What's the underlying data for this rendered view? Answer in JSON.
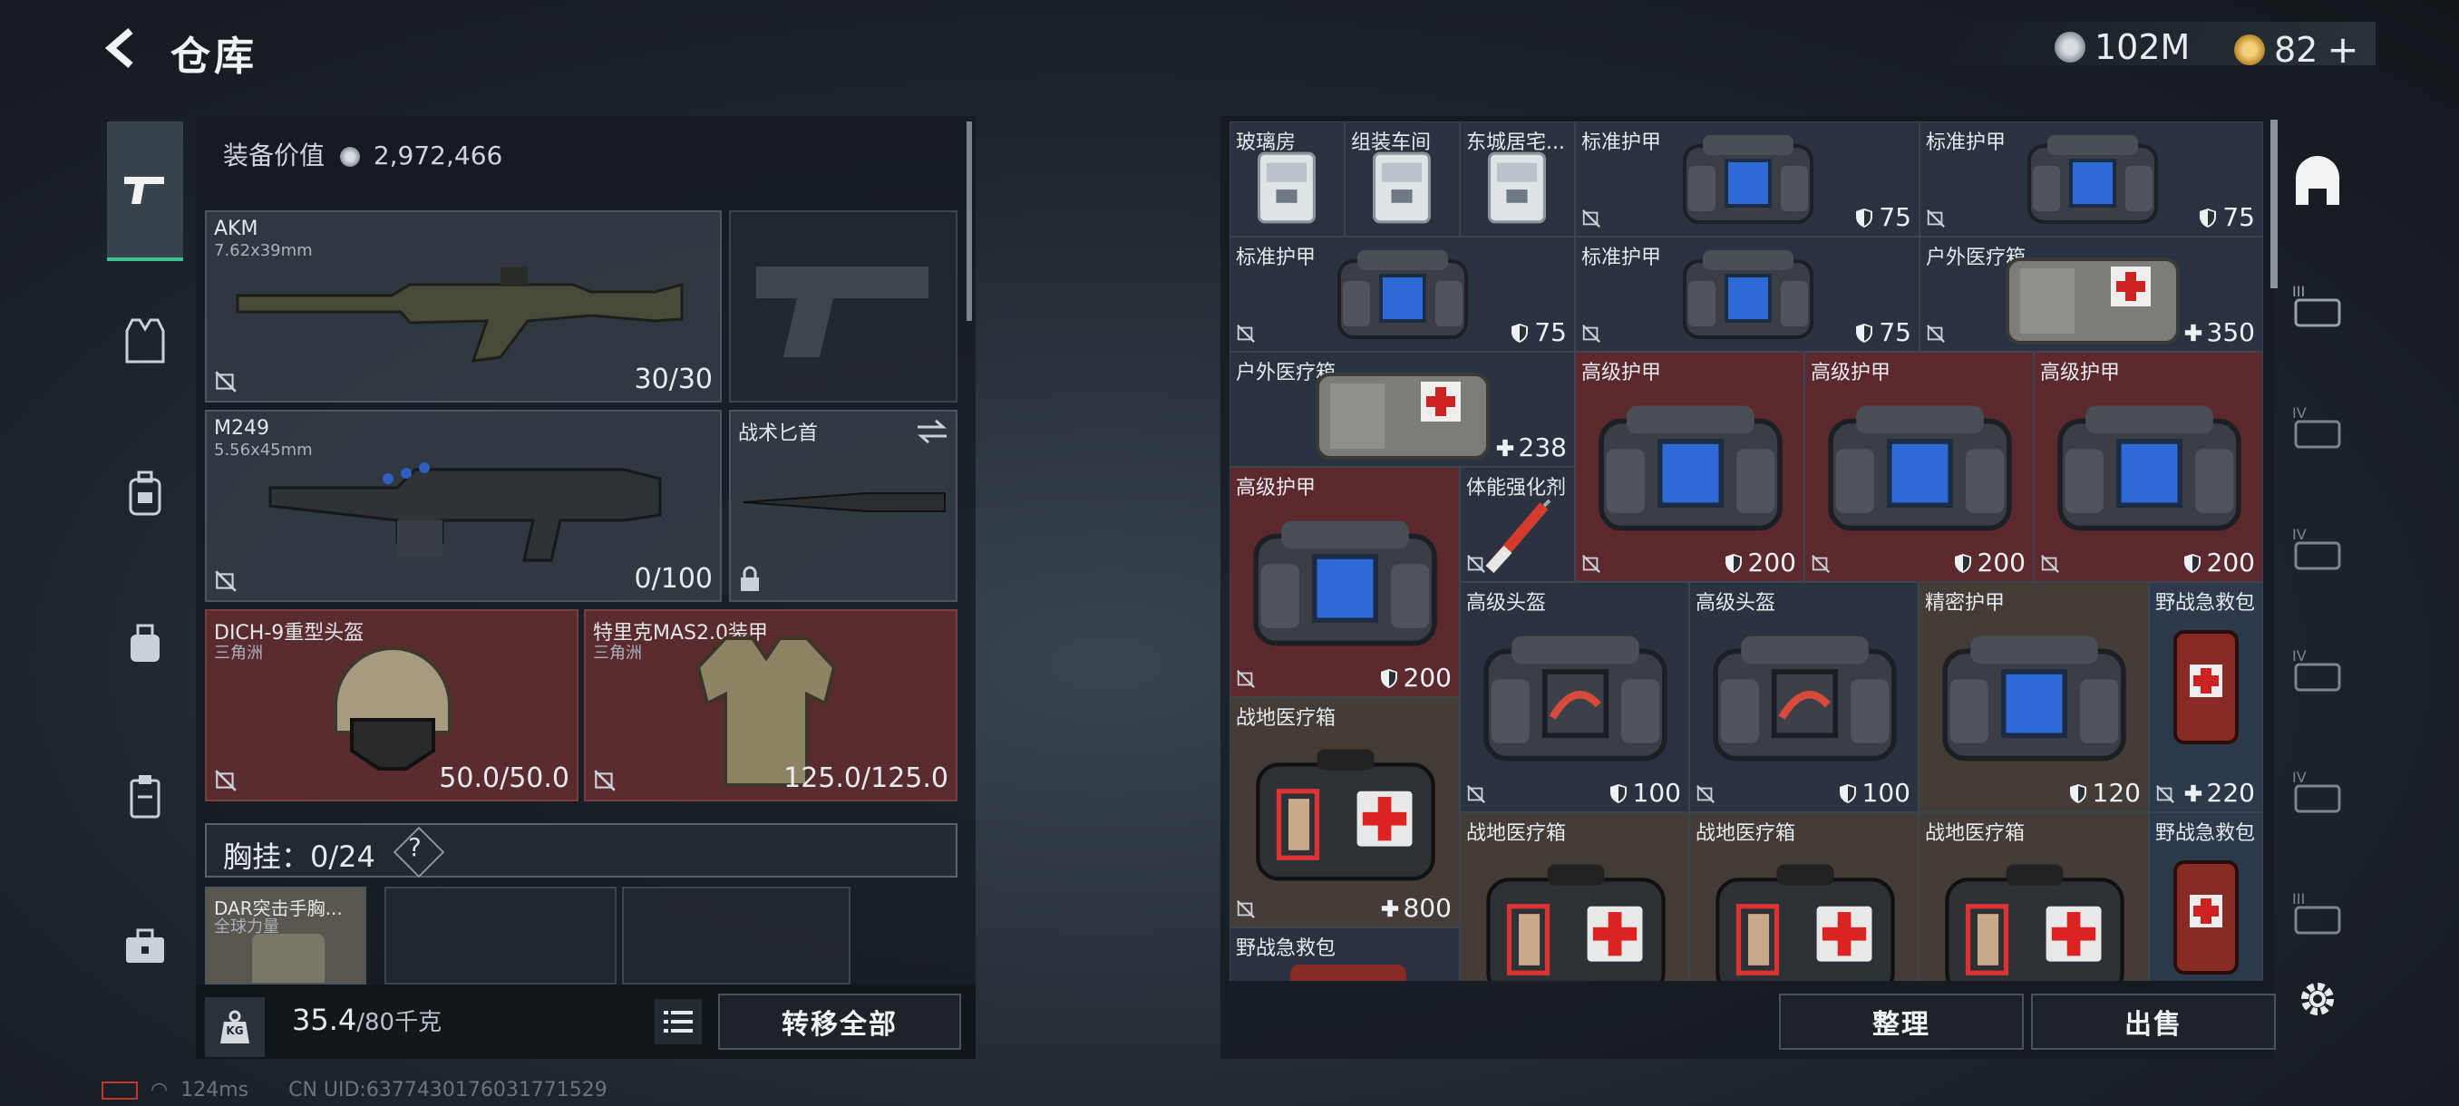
{
  "header": {
    "title": "仓库",
    "currency_silver": "102M",
    "currency_gold": "82"
  },
  "left": {
    "equipment_value_label": "装备价值",
    "equipment_value": "2,972,466",
    "slots": [
      {
        "name": "AKM",
        "sub": "7.62x39mm",
        "count": "30/30"
      },
      {
        "name": "M249",
        "sub": "5.56x45mm",
        "count": "0/100"
      },
      {
        "name": "战术匕首"
      },
      {
        "name": "DICH-9重型头盔",
        "sub": "三角洲",
        "count": "50.0/50.0"
      },
      {
        "name": "特里克MAS2.0装甲",
        "sub": "三角洲",
        "count": "125.0/125.0"
      },
      {
        "name": "DAR突击手胸...",
        "sub": "全球力量"
      }
    ],
    "chest_rig": "胸挂：0/24",
    "chest_help": "?",
    "weight": "35.4",
    "weight_max": "/80千克",
    "kg_badge": "KG",
    "transfer_all": "转移全部"
  },
  "right": {
    "items": [
      {
        "name": "玻璃房"
      },
      {
        "name": "组装车间"
      },
      {
        "name": "东城居宅..."
      },
      {
        "name": "标准护甲",
        "val": "75"
      },
      {
        "name": "标准护甲",
        "val": "75"
      },
      {
        "name": "标准护甲",
        "val": "75"
      },
      {
        "name": "标准护甲",
        "val": "75"
      },
      {
        "name": "户外医疗箱",
        "val": "350"
      },
      {
        "name": "户外医疗箱",
        "val": "238"
      },
      {
        "name": "高级护甲",
        "val": "200"
      },
      {
        "name": "高级护甲",
        "val": "200"
      },
      {
        "name": "高级护甲",
        "val": "200"
      },
      {
        "name": "高级护甲",
        "val": "200"
      },
      {
        "name": "体能强化剂"
      },
      {
        "name": "高级头盔",
        "val": "100"
      },
      {
        "name": "高级头盔",
        "val": "100"
      },
      {
        "name": "精密护甲",
        "val": "120"
      },
      {
        "name": "野战急救包",
        "val": "220"
      },
      {
        "name": "战地医疗箱",
        "val": "800"
      },
      {
        "name": "战地医疗箱"
      },
      {
        "name": "战地医疗箱"
      },
      {
        "name": "战地医疗箱"
      },
      {
        "name": "野战急救包"
      },
      {
        "name": "野战急救包"
      }
    ],
    "sort": "整理",
    "sell": "出售"
  },
  "footer": {
    "ping": "124ms",
    "uid": "CN UID:6377430176031771529"
  },
  "colors": {
    "accent_green": "#3ec28f",
    "red_cell": "#5c2a2e",
    "blue_cell": "#2c3a4c"
  },
  "icons": [
    "back-icon",
    "silver-coin-icon",
    "gold-coin-icon",
    "plus-icon",
    "gun-icon",
    "vest-icon",
    "backpack-icon",
    "container-icon",
    "case-icon",
    "toolbox-icon",
    "weight-icon",
    "list-icon",
    "shield-icon",
    "heal-icon",
    "no-drop-icon",
    "lock-icon",
    "swap-icon",
    "gear-icon",
    "bunker-icon"
  ]
}
